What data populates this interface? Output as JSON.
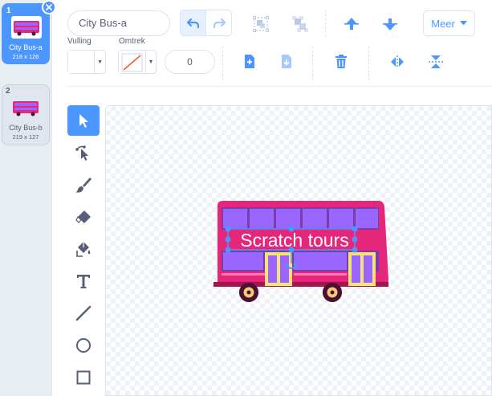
{
  "costumes": [
    {
      "number": "1",
      "name": "City Bus-a",
      "size": "218 x 126",
      "selected": true
    },
    {
      "number": "2",
      "name": "City Bus-b",
      "size": "219 x 127",
      "selected": false
    }
  ],
  "toolbar": {
    "costume_name": "City Bus-a",
    "more_label": "Meer",
    "fill_label": "Vulling",
    "outline_label": "Omtrek",
    "outline_width": "0"
  },
  "tools": [
    "select-tool",
    "reshape-tool",
    "brush-tool",
    "eraser-tool",
    "fill-tool",
    "text-tool",
    "line-tool",
    "circle-tool",
    "rectangle-tool"
  ],
  "canvas": {
    "text_object": "Scratch tours"
  },
  "colors": {
    "accent": "#4c97ff",
    "bus_body": "#e6267a",
    "bus_windows": "#9966ff",
    "bus_doors": "#f5e27a"
  }
}
